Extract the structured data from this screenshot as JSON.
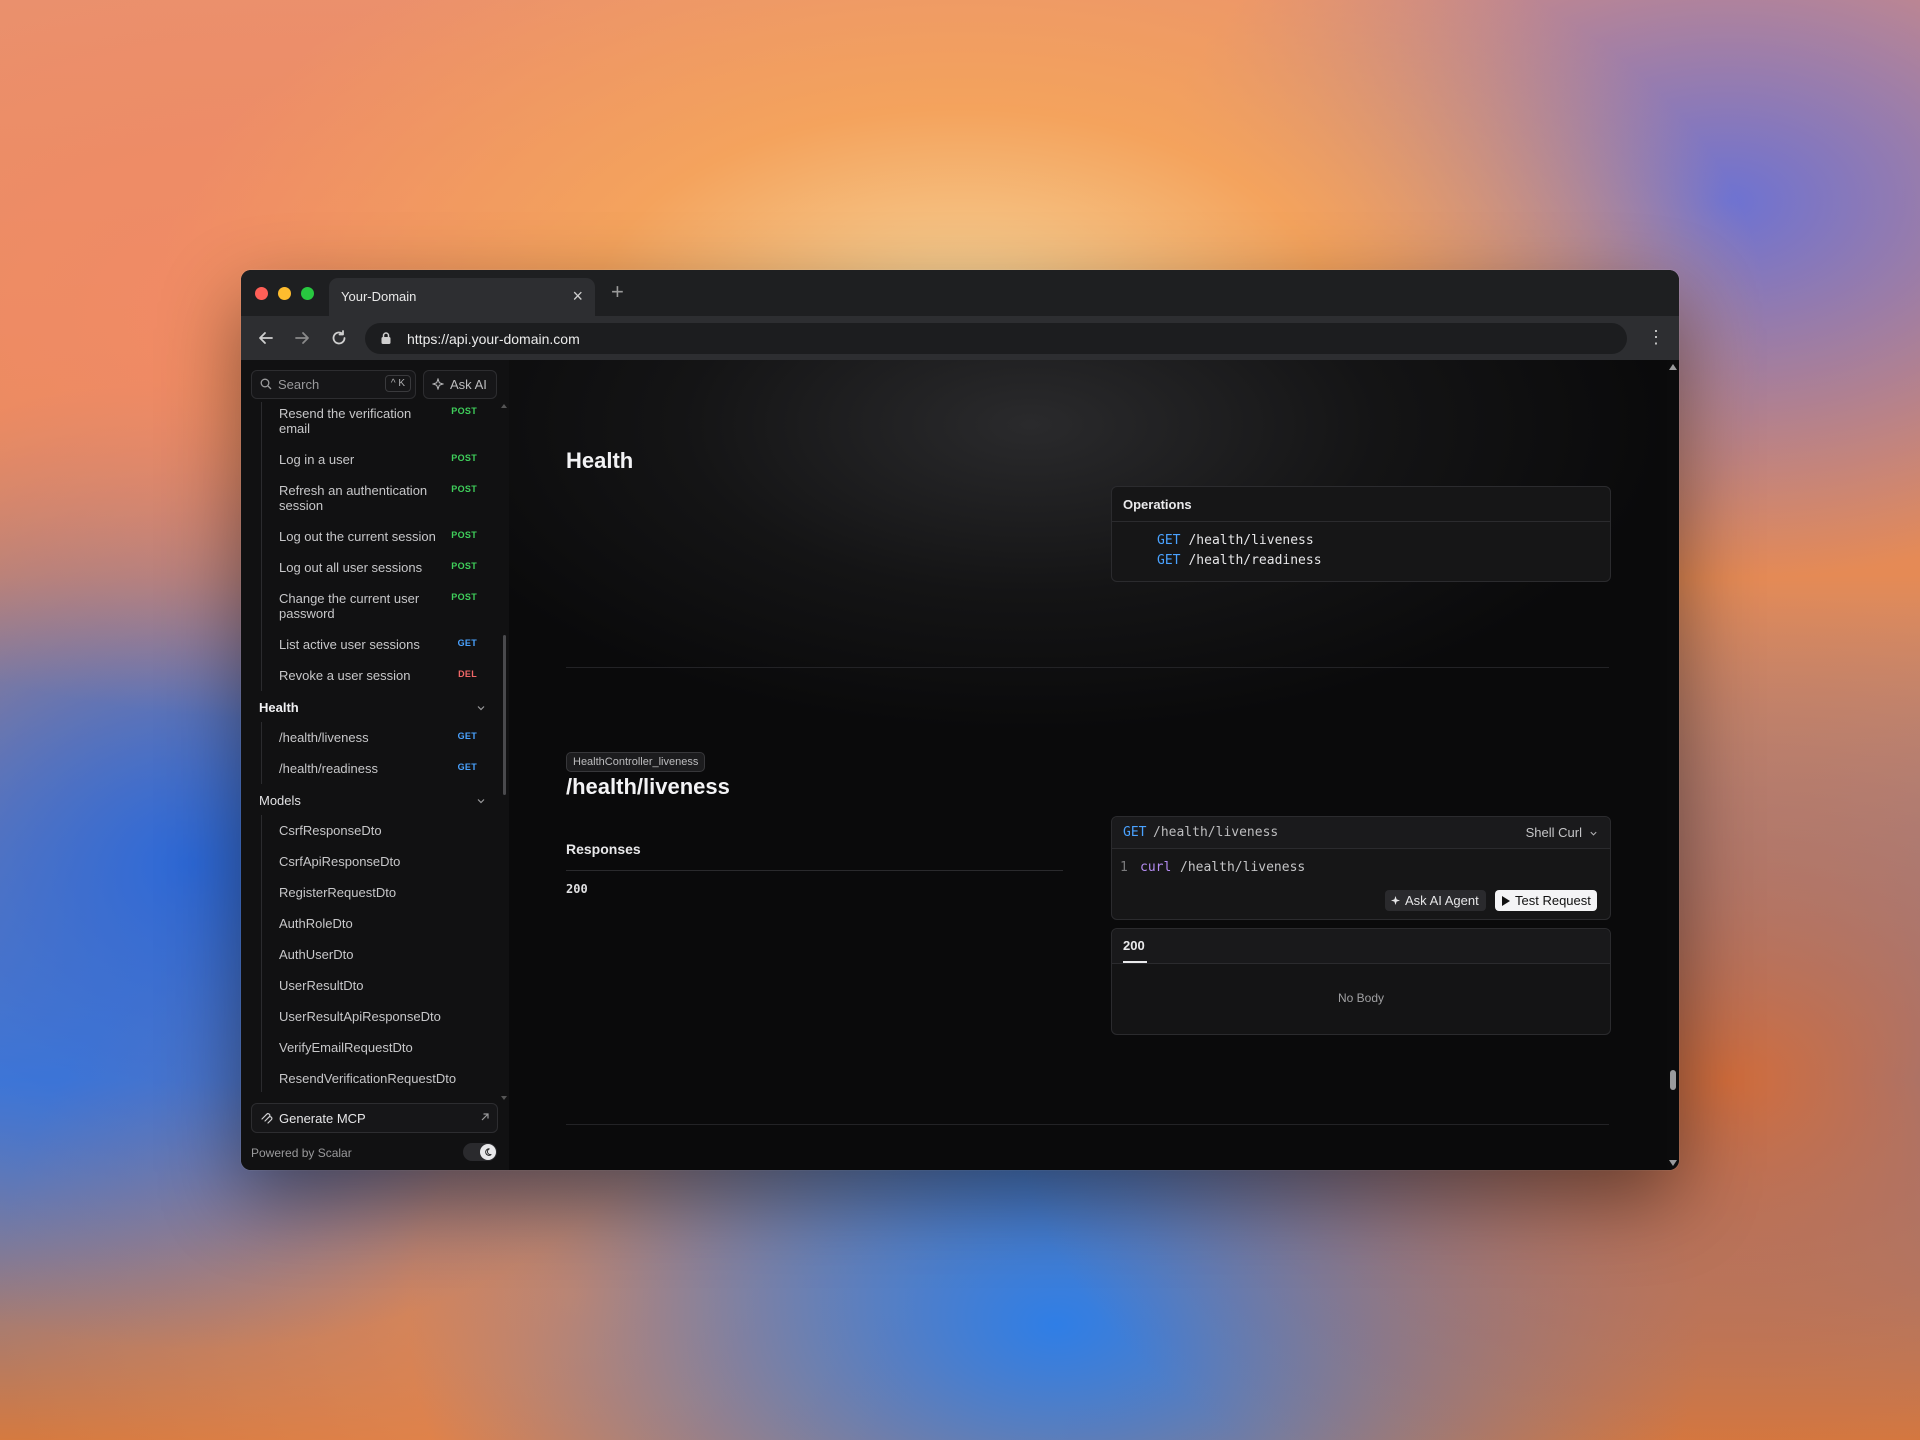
{
  "browser": {
    "tab_title": "Your-Domain",
    "tab_close": "×",
    "new_tab": "+",
    "url": "https://api.your-domain.com"
  },
  "sidebar": {
    "search_placeholder": "Search",
    "search_shortcut": "^ K",
    "ask_ai": "Ask AI",
    "items": [
      {
        "label": "Resend the verification email",
        "method": "POST"
      },
      {
        "label": "Log in a user",
        "method": "POST"
      },
      {
        "label": "Refresh an authentication session",
        "method": "POST"
      },
      {
        "label": "Log out the current session",
        "method": "POST"
      },
      {
        "label": "Log out all user sessions",
        "method": "POST"
      },
      {
        "label": "Change the current user password",
        "method": "POST"
      },
      {
        "label": "List active user sessions",
        "method": "GET"
      },
      {
        "label": "Revoke a user session",
        "method": "DEL"
      }
    ],
    "health_group": "Health",
    "health_items": [
      {
        "label": "/health/liveness",
        "method": "GET"
      },
      {
        "label": "/health/readiness",
        "method": "GET"
      }
    ],
    "models_group": "Models",
    "models": [
      "CsrfResponseDto",
      "CsrfApiResponseDto",
      "RegisterRequestDto",
      "AuthRoleDto",
      "AuthUserDto",
      "UserResultDto",
      "UserResultApiResponseDto",
      "VerifyEmailRequestDto",
      "ResendVerificationRequestDto"
    ],
    "generate_mcp": "Generate MCP",
    "powered_by": "Powered by Scalar"
  },
  "main": {
    "section_title": "Health",
    "operations_title": "Operations",
    "operations": [
      {
        "method": "GET",
        "path": "/health/liveness"
      },
      {
        "method": "GET",
        "path": "/health/readiness"
      }
    ],
    "operation_id": "HealthController_liveness",
    "endpoint_title": "/health/liveness",
    "responses_title": "Responses",
    "response_code": "200",
    "request": {
      "method": "GET",
      "path": "/health/liveness",
      "language": "Shell Curl",
      "line_number": "1",
      "command": "curl",
      "command_arg": "/health/liveness",
      "ask_agent": "Ask AI Agent",
      "test_request": "Test Request"
    },
    "response_card": {
      "tab": "200",
      "body": "No Body"
    }
  }
}
